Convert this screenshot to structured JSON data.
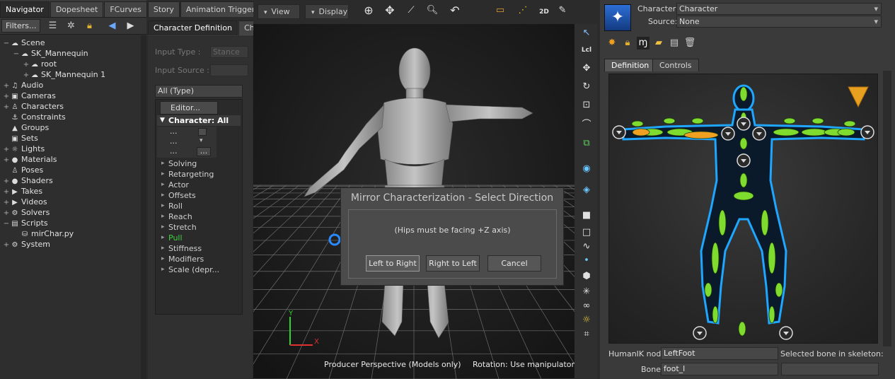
{
  "navigator": {
    "tabs": [
      "Navigator",
      "Dopesheet",
      "FCurves",
      "Story",
      "Animation Trigger"
    ],
    "active_tab": 0,
    "filters_label": "Filters...",
    "tree": [
      {
        "label": "Scene",
        "depth": 0,
        "expander": "−",
        "icon": "scene-icon"
      },
      {
        "label": "SK_Mannequin",
        "depth": 1,
        "expander": "−",
        "icon": "model-icon"
      },
      {
        "label": "root",
        "depth": 2,
        "expander": "+",
        "icon": "model-icon"
      },
      {
        "label": "SK_Mannequin 1",
        "depth": 2,
        "expander": "+",
        "icon": "model-icon"
      },
      {
        "label": "Audio",
        "depth": 0,
        "expander": "+",
        "icon": "audio-icon"
      },
      {
        "label": "Cameras",
        "depth": 0,
        "expander": "+",
        "icon": "camera-icon"
      },
      {
        "label": "Characters",
        "depth": 0,
        "expander": "+",
        "icon": "character-icon"
      },
      {
        "label": "Constraints",
        "depth": 0,
        "expander": "",
        "icon": "constraint-icon"
      },
      {
        "label": "Groups",
        "depth": 0,
        "expander": "",
        "icon": "group-icon"
      },
      {
        "label": "Sets",
        "depth": 0,
        "expander": "",
        "icon": "set-icon"
      },
      {
        "label": "Lights",
        "depth": 0,
        "expander": "+",
        "icon": "light-icon"
      },
      {
        "label": "Materials",
        "depth": 0,
        "expander": "+",
        "icon": "material-icon"
      },
      {
        "label": "Poses",
        "depth": 0,
        "expander": "",
        "icon": "pose-icon"
      },
      {
        "label": "Shaders",
        "depth": 0,
        "expander": "+",
        "icon": "shader-icon"
      },
      {
        "label": "Takes",
        "depth": 0,
        "expander": "+",
        "icon": "take-icon"
      },
      {
        "label": "Videos",
        "depth": 0,
        "expander": "+",
        "icon": "video-icon"
      },
      {
        "label": "Solvers",
        "depth": 0,
        "expander": "+",
        "icon": "solver-icon"
      },
      {
        "label": "Scripts",
        "depth": 0,
        "expander": "−",
        "icon": "script-icon"
      },
      {
        "label": "mirChar.py",
        "depth": 1,
        "expander": "",
        "icon": "python-icon"
      },
      {
        "label": "System",
        "depth": 0,
        "expander": "+",
        "icon": "system-icon"
      }
    ]
  },
  "chardef": {
    "tabs": [
      "Character Definition",
      "Cha"
    ],
    "input_type_label": "Input Type :",
    "input_type_value": "Stance",
    "input_source_label": "Input Source :",
    "input_source_value": "",
    "filter_label": "All (Type)",
    "editor_label": "Editor...",
    "list_header": "Character: All",
    "ellipsis_rows": [
      "...",
      "...",
      "..."
    ],
    "ellipsis_button": "...",
    "properties": [
      "Solving",
      "Retargeting",
      "Actor",
      "Offsets",
      "Roll",
      "Reach",
      "Stretch",
      "Pull",
      "Stiffness",
      "Modifiers",
      "Scale (depr..."
    ],
    "highlight_color": "#3fd13f"
  },
  "viewer": {
    "view_label": "View",
    "display_label": "Display",
    "status_left": "Producer Perspective (Models only)",
    "status_right": "Rotation: Use manipulator",
    "axis_x": "X",
    "axis_y": "Y",
    "tool_2d": "2D",
    "tool_lcl": "Lcl"
  },
  "dialog": {
    "title": "Mirror Characterization - Select Direction",
    "message": "(Hips must be facing +Z axis)",
    "buttons": [
      "Left to Right",
      "Right to Left",
      "Cancel"
    ]
  },
  "character_controls": {
    "character_label": "Character:",
    "character_value": "Character",
    "source_label": "Source:",
    "source_value": "None",
    "tabs": [
      "Definition",
      "Controls"
    ],
    "active_tab": 0,
    "humanik_label": "HumanIK node",
    "humanik_value": "LeftFoot",
    "selected_bone_label": "Selected bone in skeleton:",
    "bone_label": "Bone",
    "bone_value": "foot_l",
    "colors": {
      "bone_green": "#7fdc2f",
      "bone_selected": "#f0a020",
      "body_glow": "#1fa6ff"
    }
  }
}
